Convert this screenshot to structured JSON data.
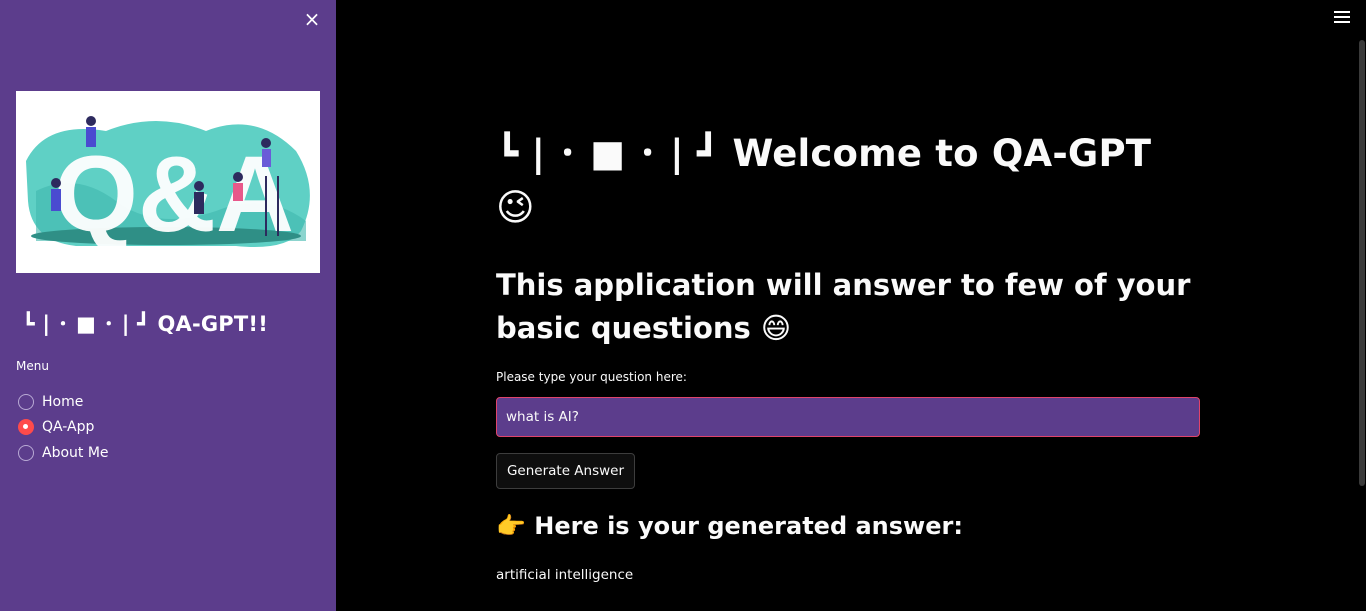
{
  "sidebar": {
    "close_icon": "×",
    "title": "┗ | ･ ■ ･ | ┛ QA-GPT!!",
    "menu_label": "Menu",
    "menu_items": [
      {
        "label": "Home",
        "selected": false
      },
      {
        "label": "QA-App",
        "selected": true
      },
      {
        "label": "About Me",
        "selected": false
      }
    ],
    "banner": {
      "icon": "q-and-a-illustration",
      "text": "Q&A"
    }
  },
  "main": {
    "title": "┗ | ･ ■ ･ | ┛ Welcome to QA-GPT 😉",
    "subtitle": "This application will answer to few of your basic questions 😄",
    "input_label": "Please type your question here:",
    "input_value": "what is AI?",
    "button_label": "Generate Answer",
    "answer_heading": "👉 Here is your generated answer:",
    "answer_text": "artificial intelligence"
  },
  "colors": {
    "sidebar_bg": "#5c3d8c",
    "main_bg": "#000000",
    "accent": "#ff4b4b",
    "input_border": "#e0446b"
  }
}
